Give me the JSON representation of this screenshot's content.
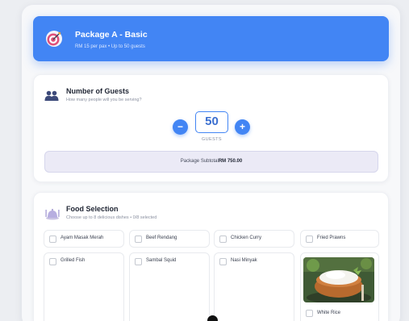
{
  "package": {
    "title": "Package A - Basic",
    "subtitle": "RM 15 per pax • Up to 50 guests",
    "icon": "target-icon"
  },
  "guests": {
    "title": "Number of Guests",
    "subtitle": "How many people will you be serving?",
    "icon": "people-icon",
    "decrement_label": "−",
    "increment_label": "+",
    "value": "50",
    "unit": "GUESTS",
    "subtotal_label": "Package Subtotal",
    "subtotal_value": "RM 750.00"
  },
  "food": {
    "title": "Food Selection",
    "subtitle": "Choose up to 8 delicious dishes • 0/8 selected",
    "icon": "dining-icon",
    "items": [
      {
        "label": "Ayam Masak Merah",
        "checked": false
      },
      {
        "label": "Beef Rendang",
        "checked": false
      },
      {
        "label": "Chicken Curry",
        "checked": false
      },
      {
        "label": "Fried Prawns",
        "checked": false
      },
      {
        "label": "Grilled Fish",
        "checked": false
      },
      {
        "label": "Sambal Squid",
        "checked": false
      },
      {
        "label": "Nasi Minyak",
        "checked": false
      },
      {
        "label": "White Rice",
        "checked": false
      }
    ]
  },
  "colors": {
    "accent": "#4285f4",
    "subtotal_bg": "#ebeaf6",
    "page_bg": "#eceef2"
  }
}
